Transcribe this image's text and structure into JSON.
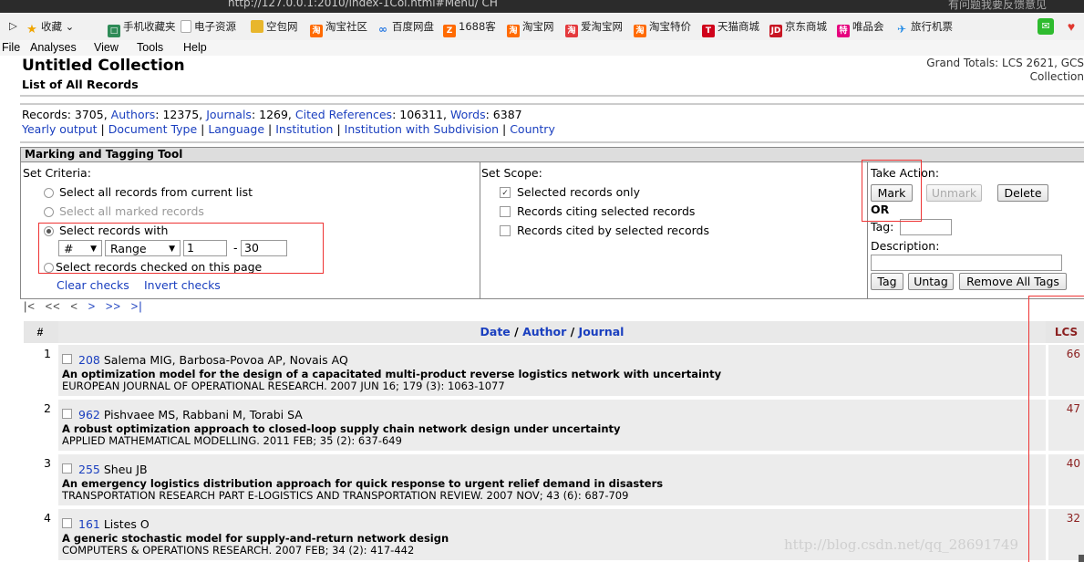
{
  "chrome": {
    "url_fragment": "http://127.0.0.1:2010/index-1Col.html#Menu/  CH",
    "right_fragment": "有问题我要反馈意见"
  },
  "bookmarks": [
    {
      "label": "收藏 ⌄",
      "icon": "star-icon",
      "color": "#f0a500"
    },
    {
      "label": "手机收藏夹",
      "icon": "phone-icon",
      "color": "#2e8b57"
    },
    {
      "label": "电子资源",
      "icon": "document-icon",
      "color": "#888888"
    },
    {
      "label": "空包网",
      "icon": "folder-icon",
      "color": "#e8b62c"
    },
    {
      "label": "淘宝社区",
      "icon": "taobao-icon",
      "color": "#ff6a00"
    },
    {
      "label": "百度网盘",
      "icon": "cloud-icon",
      "color": "#2a7ae2"
    },
    {
      "label": "1688客",
      "icon": "1688-icon",
      "color": "#ff6a00"
    },
    {
      "label": "淘宝网",
      "icon": "taobao-icon",
      "color": "#ff6a00"
    },
    {
      "label": "爱淘宝网",
      "icon": "aitaobao-icon",
      "color": "#e4393c"
    },
    {
      "label": "淘宝特价",
      "icon": "taobao-icon",
      "color": "#ff6a00"
    },
    {
      "label": "天猫商城",
      "icon": "tmall-icon",
      "color": "#d0021b"
    },
    {
      "label": "京东商城",
      "icon": "jd-icon",
      "color": "#c81623"
    },
    {
      "label": "唯品会",
      "icon": "vip-icon",
      "color": "#e6007e"
    },
    {
      "label": "旅行机票",
      "icon": "plane-icon",
      "color": "#1e88e5"
    }
  ],
  "menu": [
    "File",
    "Analyses",
    "View",
    "Tools",
    "Help"
  ],
  "header": {
    "title": "Untitled Collection",
    "subtitle": "List of All Records",
    "grand_totals_line1": "Grand Totals: LCS 2621, GCS",
    "grand_totals_line2": "Collection"
  },
  "stats": {
    "records_label": "Records: 3705,",
    "authors_link": "Authors",
    "authors_value": ": 12375,",
    "journals_link": "Journals",
    "journals_value": ": 1269,",
    "cited_link": "Cited References",
    "cited_value": ": 106311,",
    "words_link": "Words",
    "words_value": ": 6387",
    "links": [
      "Yearly output",
      "Document Type",
      "Language",
      "Institution",
      "Institution with Subdivision",
      "Country"
    ]
  },
  "tool": {
    "title": "Marking and Tagging Tool",
    "criteria_label": "Set Criteria:",
    "criteria_options": [
      "Select all records from current list",
      "Select all marked records",
      "Select records with",
      "Select records checked on this page"
    ],
    "field_select": "#",
    "op_select": "Range",
    "range_from": "1",
    "range_dash": "-",
    "range_to": "30",
    "clear_checks": "Clear checks",
    "invert_checks": "Invert checks",
    "scope_label": "Set Scope:",
    "scope_options": [
      "Selected records only",
      "Records citing selected records",
      "Records cited by selected records"
    ],
    "action_label": "Take Action:",
    "mark": "Mark",
    "unmark": "Unmark",
    "delete": "Delete",
    "or": "OR",
    "tag_label": "Tag:",
    "description_label": "Description:",
    "tag_btn": "Tag",
    "untag_btn": "Untag",
    "remove_all_tags_btn": "Remove All Tags"
  },
  "nav": [
    "|<",
    "<<",
    "<",
    ">",
    ">>",
    ">|"
  ],
  "table": {
    "col_num": "#",
    "col_date": "Date",
    "sep": " / ",
    "col_author": "Author",
    "col_journal": "Journal",
    "col_lcs": "LCS",
    "rows": [
      {
        "n": "1",
        "id": "208",
        "authors": "Salema MIG, Barbosa-Povoa AP, Novais AQ",
        "title": "An optimization model for the design of a capacitated multi-product reverse logistics network with uncertainty",
        "source": "EUROPEAN JOURNAL OF OPERATIONAL RESEARCH. 2007 JUN 16; 179 (3): 1063-1077",
        "lcs": "66"
      },
      {
        "n": "2",
        "id": "962",
        "authors": "Pishvaee MS, Rabbani M, Torabi SA",
        "title": "A robust optimization approach to closed-loop supply chain network design under uncertainty",
        "source": "APPLIED MATHEMATICAL MODELLING. 2011 FEB; 35 (2): 637-649",
        "lcs": "47"
      },
      {
        "n": "3",
        "id": "255",
        "authors": "Sheu JB",
        "title": "An emergency logistics distribution approach for quick response to urgent relief demand in disasters",
        "source": "TRANSPORTATION RESEARCH PART E-LOGISTICS AND TRANSPORTATION REVIEW. 2007 NOV; 43 (6): 687-709",
        "lcs": "40"
      },
      {
        "n": "4",
        "id": "161",
        "authors": "Listes O",
        "title": "A generic stochastic model for supply-and-return network design",
        "source": "COMPUTERS & OPERATIONS RESEARCH. 2007 FEB; 34 (2): 417-442",
        "lcs": "32"
      }
    ]
  },
  "watermark": "http://blog.csdn.net/qq_28691749"
}
